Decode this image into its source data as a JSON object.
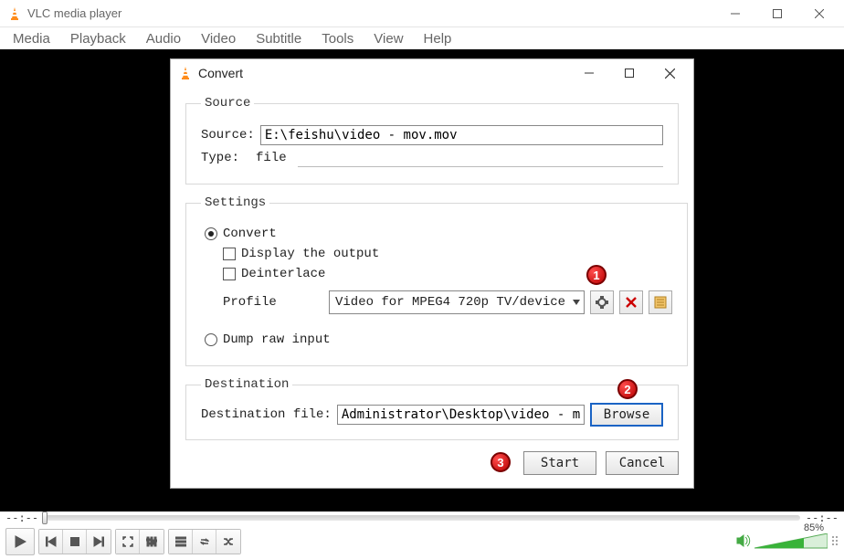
{
  "main_window": {
    "title": "VLC media player",
    "menus": [
      "Media",
      "Playback",
      "Audio",
      "Video",
      "Subtitle",
      "Tools",
      "View",
      "Help"
    ],
    "seek_time": "--:--",
    "volume_text": "85%"
  },
  "dialog": {
    "title": "Convert",
    "source": {
      "legend": "Source",
      "source_label": "Source:",
      "source_value": "E:\\feishu\\video - mov.mov",
      "type_label": "Type:",
      "type_value": "file"
    },
    "settings": {
      "legend": "Settings",
      "convert_label": "Convert",
      "display_output_label": "Display the output",
      "deinterlace_label": "Deinterlace",
      "profile_label": "Profile",
      "profile_value": "Video for MPEG4 720p TV/device",
      "dump_raw_label": "Dump raw input"
    },
    "destination": {
      "legend": "Destination",
      "dest_label": "Destination file:",
      "dest_value": "Administrator\\Desktop\\video - mov.mov",
      "browse_label": "Browse"
    },
    "buttons": {
      "start": "Start",
      "cancel": "Cancel"
    }
  },
  "annotations": {
    "a1": "1",
    "a2": "2",
    "a3": "3"
  }
}
